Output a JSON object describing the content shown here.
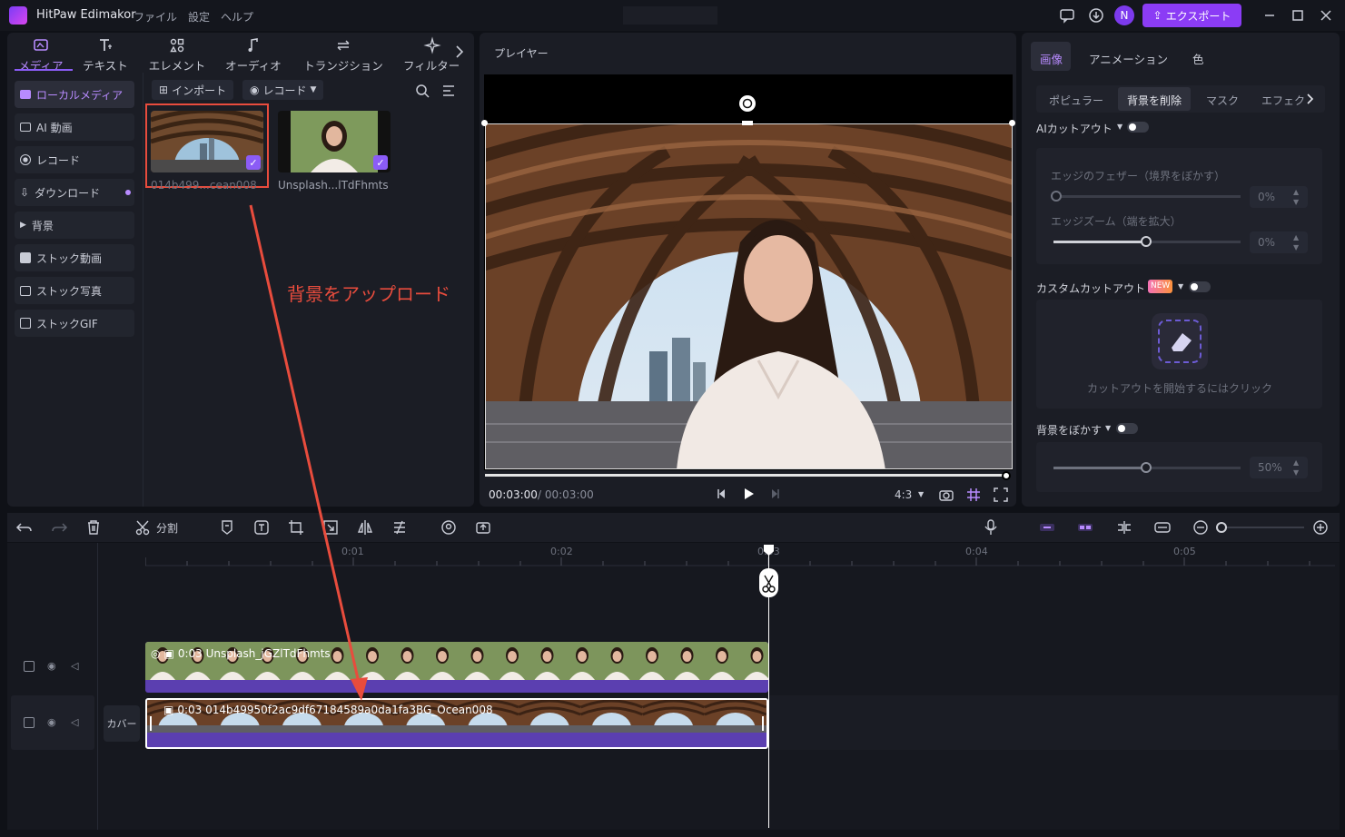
{
  "app": {
    "title": "HitPaw Edimakor",
    "menu": [
      "ファイル",
      "設定",
      "ヘルプ"
    ],
    "export_label": "エクスポート",
    "avatar_initial": "N"
  },
  "left": {
    "tabs": [
      "メディア",
      "テキスト",
      "エレメント",
      "オーディオ",
      "トランジション",
      "フィルター"
    ],
    "sidebar": [
      "ローカルメディア",
      "AI 動画",
      "レコード",
      "ダウンロード",
      "背景",
      "ストック動画",
      "ストック写真",
      "ストックGIF"
    ],
    "import_label": "インポート",
    "record_label": "レコード",
    "media": [
      {
        "name": "014b499...cean008"
      },
      {
        "name": "Unsplash...lTdFhmts"
      }
    ]
  },
  "player": {
    "title": "プレイヤー",
    "time_current": "00:03:00",
    "time_total": "/ 00:03:00",
    "ratio": "4:3"
  },
  "right": {
    "tabs": [
      "画像",
      "アニメーション",
      "色"
    ],
    "subtabs": [
      "ポピュラー",
      "背景を削除",
      "マスク",
      "エフェク"
    ],
    "ai_cutout": "AIカットアウト",
    "edge_feather": "エッジのフェザー（境界をぼかす）",
    "edge_feather_value": "0%",
    "edge_zoom": "エッジズーム（端を拡大）",
    "edge_zoom_value": "0%",
    "custom_cutout": "カスタムカットアウト",
    "new_badge": "NEW",
    "cutout_hint": "カットアウトを開始するにはクリック",
    "blur_bg": "背景をぼかす",
    "blur_value": "50%"
  },
  "toolbar": {
    "split_label": "分割"
  },
  "timeline": {
    "ticks": [
      "0:01",
      "0:02",
      "0:03",
      "0:04",
      "0:05"
    ],
    "clip_top": "0:03 Unsplash_jGZlTdFhmts",
    "clip_bottom": "0:03 014b49950f2ac9df67184589a0da1fa3BG_Ocean008",
    "cover_label": "カバー"
  },
  "annotation": "背景をアップロード",
  "colors": {
    "accent": "#8b5cf6",
    "annotation": "#e84c3d",
    "clip_bar": "#5b3fb0"
  }
}
